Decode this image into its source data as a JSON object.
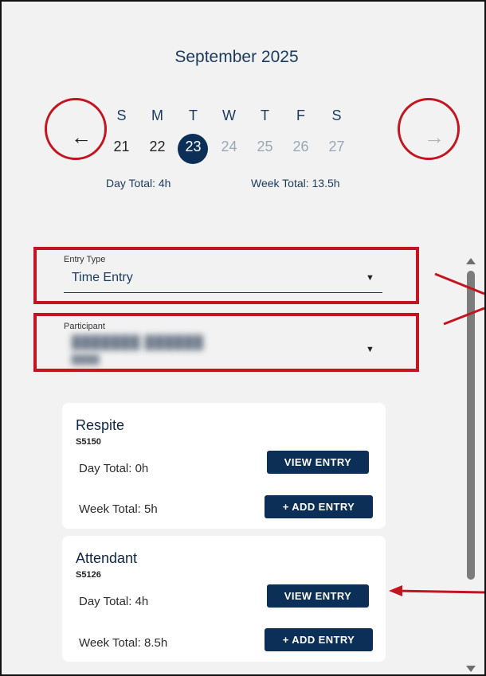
{
  "calendar": {
    "month_label": "September 2025",
    "weekdays": [
      "S",
      "M",
      "T",
      "W",
      "T",
      "F",
      "S"
    ],
    "dates": [
      "21",
      "22",
      "23",
      "24",
      "25",
      "26",
      "27"
    ],
    "selected_date": "23",
    "prev_icon": "arrow-left-icon",
    "next_icon": "arrow-right-icon",
    "day_total": "Day Total: 4h",
    "week_total": "Week Total: 13.5h"
  },
  "form": {
    "entry_type_label": "Entry Type",
    "entry_type_value": "Time Entry",
    "participant_label": "Participant"
  },
  "services": [
    {
      "name": "Respite",
      "code": "S5150",
      "day_total": "Day Total: 0h",
      "week_total": "Week Total: 5h",
      "view_label": "VIEW ENTRY",
      "add_label": "+ ADD ENTRY"
    },
    {
      "name": "Attendant",
      "code": "S5126",
      "day_total": "Day Total: 4h",
      "week_total": "Week Total: 8.5h",
      "view_label": "VIEW ENTRY",
      "add_label": "+ ADD ENTRY"
    }
  ],
  "colors": {
    "primary": "#0b2f57",
    "annotation": "#c3151f",
    "background": "#f2f2f2"
  }
}
